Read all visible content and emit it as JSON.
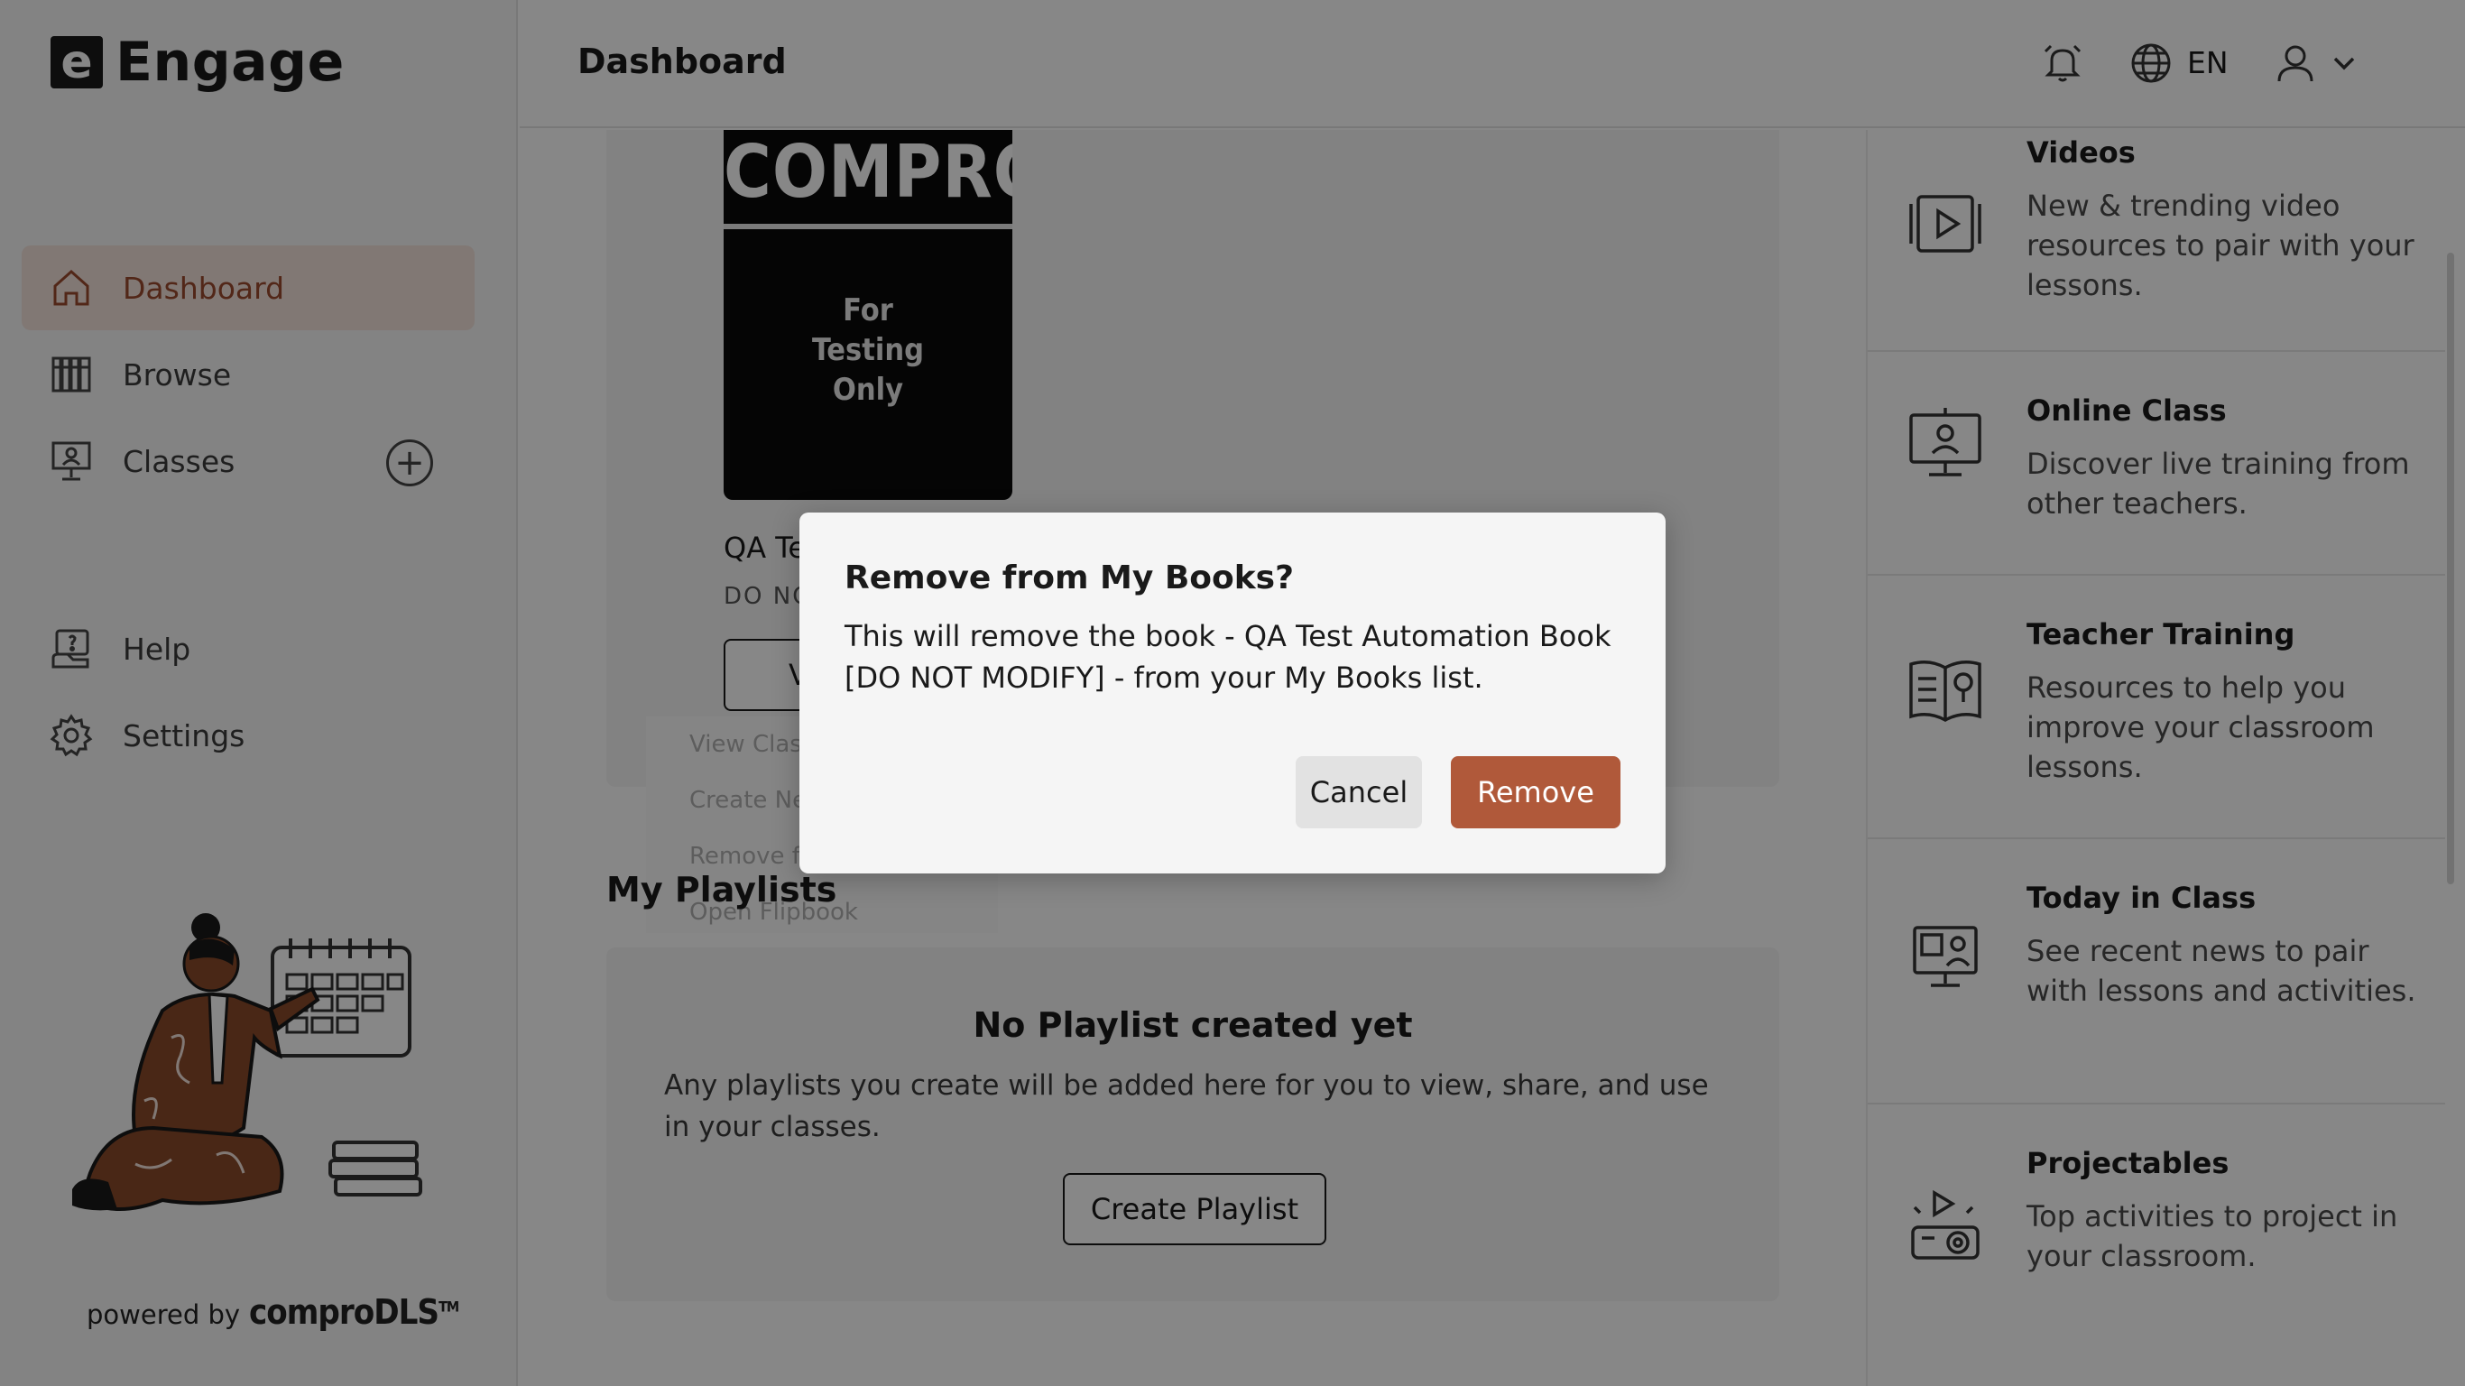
{
  "app": {
    "logo_letter": "e",
    "name": "Engage"
  },
  "sidebar": {
    "items": [
      {
        "label": "Dashboard",
        "icon": "home-icon",
        "active": true
      },
      {
        "label": "Browse",
        "icon": "books-icon",
        "active": false
      },
      {
        "label": "Classes",
        "icon": "classroom-icon",
        "active": false
      },
      {
        "label": "Help",
        "icon": "help-icon",
        "active": false
      },
      {
        "label": "Settings",
        "icon": "gear-icon",
        "active": false
      }
    ],
    "add_class_symbol": "+",
    "powered_by": "powered by",
    "powered_brand": "comproDLS",
    "powered_tm": "TM"
  },
  "header": {
    "title": "Dashboard",
    "language": "EN",
    "icons": [
      "alarm-bell-icon",
      "globe-icon",
      "user-icon",
      "chevron-down-icon"
    ]
  },
  "main": {
    "book": {
      "cover_title": "COMPRO",
      "cover_subtitle": "For\nTesting\nOnly",
      "title": "QA Test Automatio...",
      "subtitle": "DO NOT MODIFY",
      "view_label": "View"
    },
    "context_menu": [
      "View Classes",
      "Create New Class",
      "Remove from My Books",
      "Open Flipbook"
    ],
    "playlists": {
      "heading": "My Playlists",
      "empty_title": "No Playlist created yet",
      "empty_desc": "Any playlists you create will be added here for you to view, share, and use in your classes.",
      "create_label": "Create Playlist"
    }
  },
  "right_panel": {
    "items": [
      {
        "title": "Videos",
        "desc": "New & trending video resources to pair with your lessons.",
        "icon": "video-icon"
      },
      {
        "title": "Online Class",
        "desc": "Discover live training from other teachers.",
        "icon": "online-class-icon"
      },
      {
        "title": "Teacher Training",
        "desc": "Resources to help you improve your classroom lessons.",
        "icon": "teacher-training-icon"
      },
      {
        "title": "Today in Class",
        "desc": "See recent news to pair with lessons and activities.",
        "icon": "today-in-class-icon"
      },
      {
        "title": "Projectables",
        "desc": "Top activities to project in your classroom.",
        "icon": "projector-icon"
      }
    ]
  },
  "modal": {
    "title": "Remove from My Books?",
    "body": "This will remove the book - QA Test Automation Book [DO NOT MODIFY] - from your My Books list.",
    "cancel_label": "Cancel",
    "remove_label": "Remove"
  },
  "colors": {
    "accent": "#b0593a",
    "active_nav_bg": "#f3e3dc",
    "active_nav_text": "#9c4a2e"
  }
}
